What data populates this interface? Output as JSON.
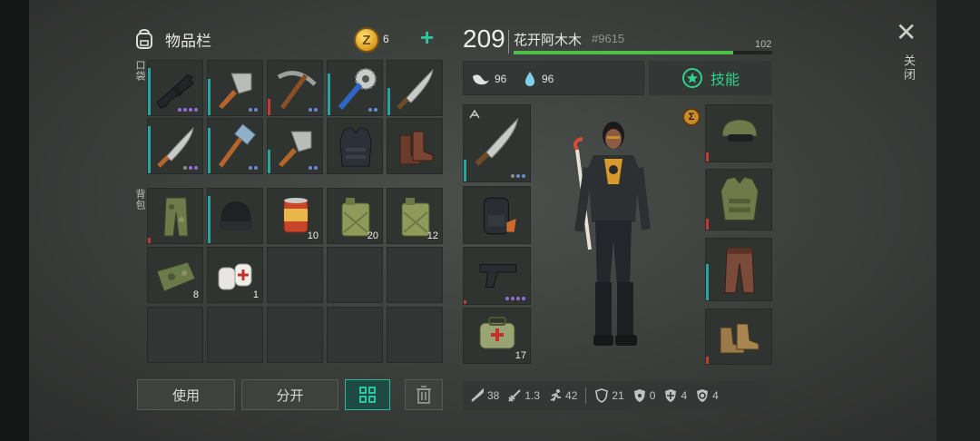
{
  "inventory": {
    "title": "物品栏",
    "coins": "6",
    "pockets_label": "口袋",
    "backpack_label": "背包",
    "pocket_items": [
      {
        "name": "assault-rifle",
        "qty": ""
      },
      {
        "name": "cleaver",
        "qty": ""
      },
      {
        "name": "pickaxe",
        "qty": ""
      },
      {
        "name": "saw-mace",
        "qty": ""
      },
      {
        "name": "machete",
        "qty": ""
      },
      {
        "name": "machete",
        "qty": ""
      },
      {
        "name": "sledgehammer",
        "qty": ""
      },
      {
        "name": "cleaver",
        "qty": ""
      },
      {
        "name": "tactical-vest",
        "qty": ""
      },
      {
        "name": "boots",
        "qty": ""
      }
    ],
    "backpack_items": [
      {
        "name": "camo-pants",
        "qty": ""
      },
      {
        "name": "beanie",
        "qty": ""
      },
      {
        "name": "food-can",
        "qty": "10"
      },
      {
        "name": "jerrycan",
        "qty": "20"
      },
      {
        "name": "jerrycan",
        "qty": "12"
      },
      {
        "name": "camo-cloth",
        "qty": "8"
      },
      {
        "name": "bandage",
        "qty": "1"
      }
    ]
  },
  "buttons": {
    "use": "使用",
    "split": "分开"
  },
  "character": {
    "level": "209",
    "name": "花开阿木木",
    "tag": "#9615",
    "xp_value": "102",
    "xp_fraction": 0.85,
    "hunger": "96",
    "thirst": "96",
    "skills_label": "技能"
  },
  "equipment": {
    "quick_slots": [
      {
        "name": "machete",
        "qty": ""
      },
      {
        "name": "backpack",
        "qty": ""
      },
      {
        "name": "pistol",
        "qty": ""
      },
      {
        "name": "medkit",
        "qty": "17"
      }
    ],
    "gear_slots": [
      "helmet",
      "vest",
      "pants",
      "boots"
    ]
  },
  "stats": {
    "damage": "38",
    "attack_speed": "1.3",
    "move_speed": "42",
    "defense": "21",
    "radiation": "0",
    "cold": "4",
    "toxic": "4"
  },
  "close_label": "关闭",
  "colors": {
    "accent": "#2fc4a0",
    "xp_bar": "#4fbe4a",
    "skill_text": "#2fd28a",
    "durability": "#2aa59b",
    "warning": "#c23a32"
  }
}
